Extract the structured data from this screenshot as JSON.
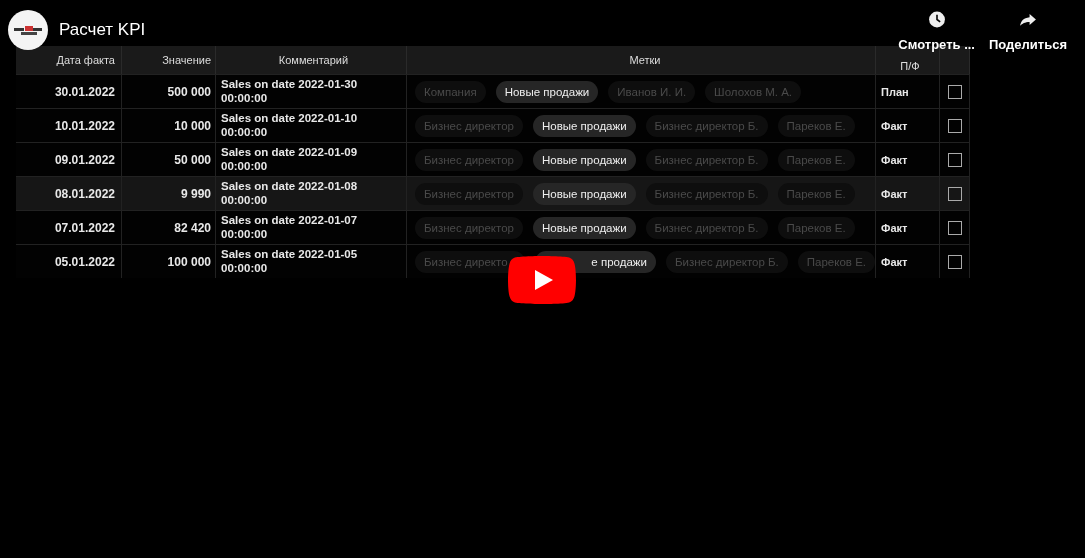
{
  "video": {
    "title": "Расчет KPI",
    "actions": [
      {
        "kind": "watch_later",
        "label": "Смотреть ..."
      },
      {
        "kind": "share",
        "label": "Поделиться"
      }
    ]
  },
  "table": {
    "columns": [
      "Дата факта",
      "Значение",
      "Комментарий",
      "Метки",
      "П/Ф"
    ],
    "rows": [
      {
        "date": "30.01.2022",
        "value": "500 000",
        "comment": "Sales on date 2022-01-30 00:00:00",
        "tags": [
          {
            "text": "Компания",
            "selected": false
          },
          {
            "text": "Новые продажи",
            "selected": true
          },
          {
            "text": "Иванов И. И.",
            "selected": false
          },
          {
            "text": "Шолохов М. А.",
            "selected": false
          }
        ],
        "pf": "План",
        "checked": false,
        "selected": false
      },
      {
        "date": "10.01.2022",
        "value": "10 000",
        "comment": "Sales on date 2022-01-10 00:00:00",
        "tags": [
          {
            "text": "Бизнес директор",
            "selected": false
          },
          {
            "text": "Новые продажи",
            "selected": true
          },
          {
            "text": "Бизнес директор Б.",
            "selected": false
          },
          {
            "text": "Парeков Е.",
            "selected": false
          }
        ],
        "pf": "Факт",
        "checked": false,
        "selected": false
      },
      {
        "date": "09.01.2022",
        "value": "50 000",
        "comment": "Sales on date 2022-01-09 00:00:00",
        "tags": [
          {
            "text": "Бизнес директор",
            "selected": false
          },
          {
            "text": "Новые продажи",
            "selected": true
          },
          {
            "text": "Бизнес директор Б.",
            "selected": false
          },
          {
            "text": "Парeков Е.",
            "selected": false
          }
        ],
        "pf": "Факт",
        "checked": false,
        "selected": false
      },
      {
        "date": "08.01.2022",
        "value": "9 990",
        "comment": "Sales on date 2022-01-08 00:00:00",
        "tags": [
          {
            "text": "Бизнес директор",
            "selected": false
          },
          {
            "text": "Новые продажи",
            "selected": true
          },
          {
            "text": "Бизнес директор Б.",
            "selected": false
          },
          {
            "text": "Парeков Е.",
            "selected": false
          }
        ],
        "pf": "Факт",
        "checked": false,
        "selected": true
      },
      {
        "date": "07.01.2022",
        "value": "82 420",
        "comment": "Sales on date 2022-01-07 00:00:00",
        "tags": [
          {
            "text": "Бизнес директор",
            "selected": false
          },
          {
            "text": "Новые продажи",
            "selected": true
          },
          {
            "text": "Бизнес директор Б.",
            "selected": false
          },
          {
            "text": "Парeков Е.",
            "selected": false
          }
        ],
        "pf": "Факт",
        "checked": false,
        "selected": false
      },
      {
        "date": "05.01.2022",
        "value": "100 000",
        "comment": "Sales on date 2022-01-05 00:00:00",
        "tags": [
          {
            "text": "Бизнес директо",
            "selected": false
          },
          {
            "text": "е продажи",
            "selected": true
          },
          {
            "text": "Бизнес директор Б.",
            "selected": false
          },
          {
            "text": "Парeков Е.",
            "selected": false
          }
        ],
        "pf": "Факт",
        "checked": false,
        "selected": false
      }
    ]
  }
}
